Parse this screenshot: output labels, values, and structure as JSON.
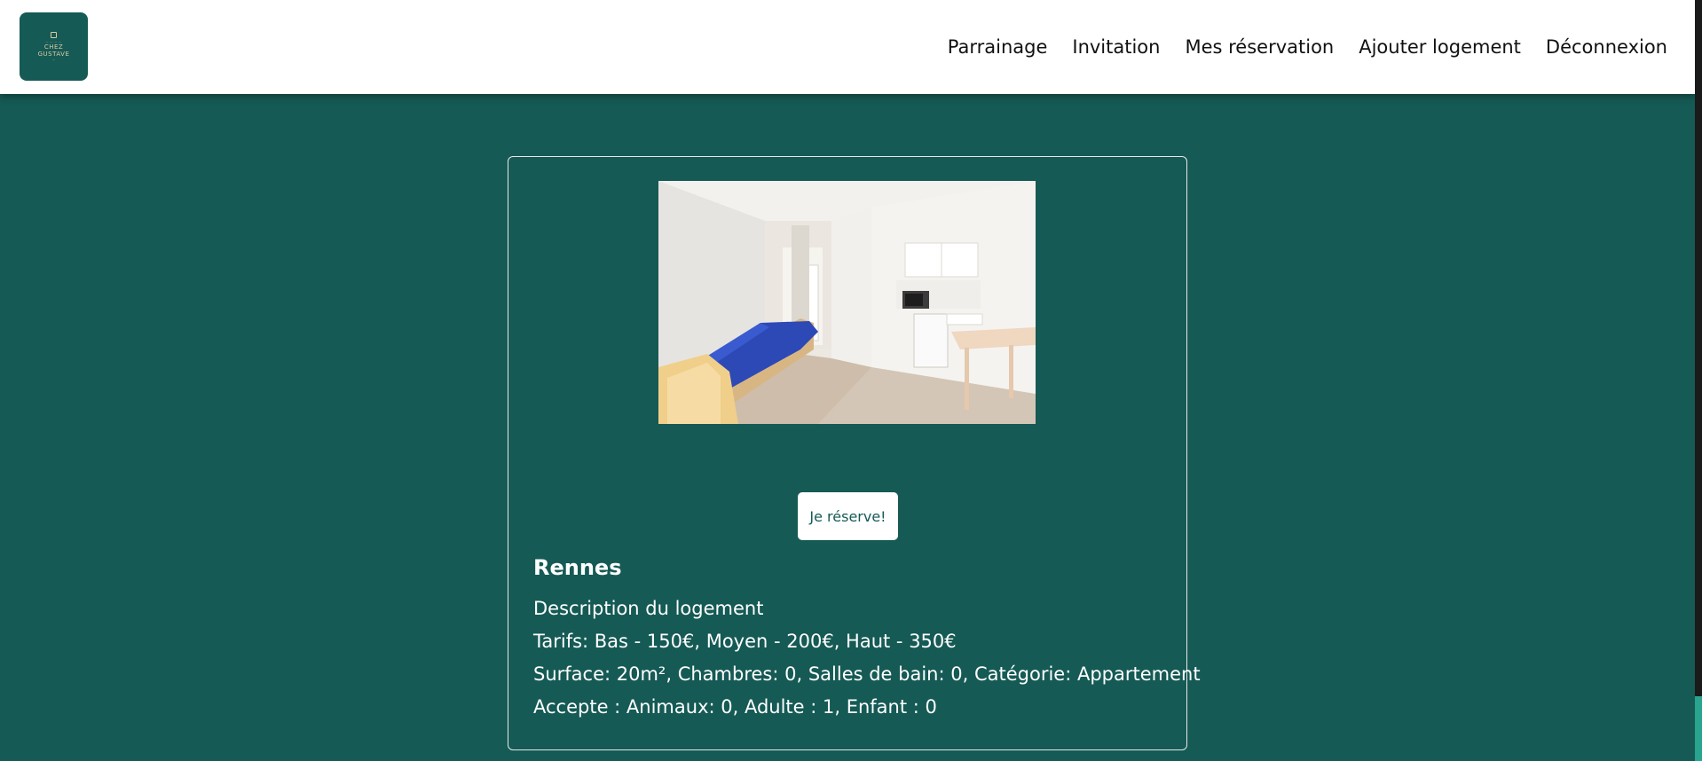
{
  "logo": {
    "line1": "CHEZ",
    "line2": "GUSTAVE"
  },
  "nav": {
    "items": [
      {
        "label": "Parrainage"
      },
      {
        "label": "Invitation"
      },
      {
        "label": "Mes réservation"
      },
      {
        "label": "Ajouter logement"
      },
      {
        "label": "Déconnexion"
      }
    ]
  },
  "listing": {
    "reserve_label": "Je réserve!",
    "city": "Rennes",
    "description": "Description du logement",
    "tarifs": "Tarifs: Bas - 150€, Moyen - 200€, Haut - 350€",
    "surface": "Surface: 20m², Chambres: 0, Salles de bain: 0, Catégorie: Appartement",
    "accepte": "Accepte : Animaux: 0, Adulte : 1, Enfant : 0"
  },
  "colors": {
    "brand": "#155a55",
    "header_bg": "#ffffff",
    "scroll_thumb": "#29a58f"
  },
  "icons": {
    "logo": "chez-gustave-logo",
    "photo": "apartment-room-photo"
  }
}
